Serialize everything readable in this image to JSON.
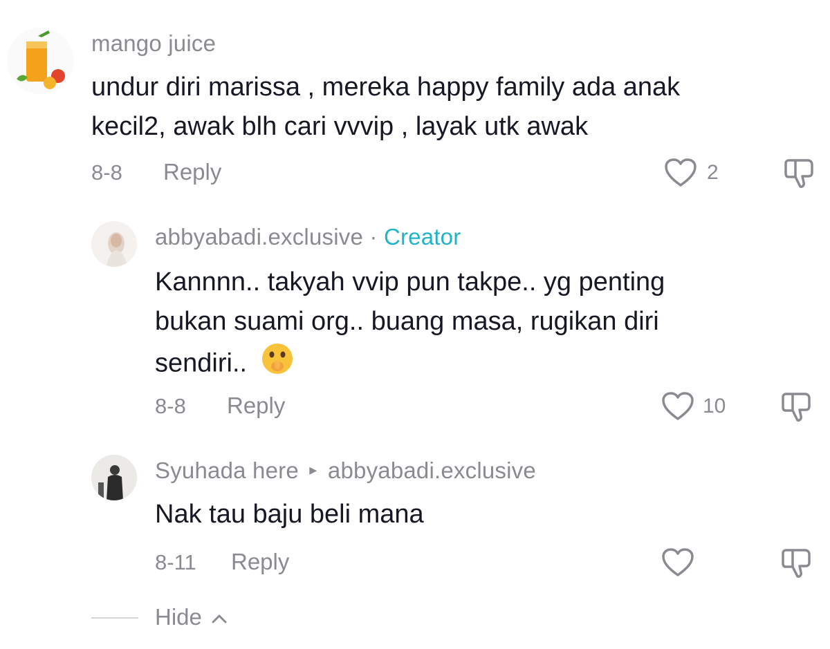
{
  "comments": [
    {
      "username": "mango juice",
      "avatar_icon": "mango-juice-avatar-icon",
      "text_line1": "undur diri marissa , mereka happy family ada anak",
      "text_line2": "kecil2, awak blh cari vvvip , layak utk awak",
      "date": "8-8",
      "reply_label": "Reply",
      "likes": "2"
    },
    {
      "username": "abbyabadi.exclusive",
      "separator": "·",
      "badge": "Creator",
      "avatar_icon": "woman-avatar-icon",
      "text_line1": "Kannnn.. takyah vvip pun takpe.. yg penting",
      "text_line2": "bukan suami org.. buang masa, rugikan diri",
      "text_line3": "sendiri..",
      "emoji": "shushing-face-emoji",
      "date": "8-8",
      "reply_label": "Reply",
      "likes": "10"
    },
    {
      "username": "Syuhada here",
      "reply_to": "abbyabadi.exclusive",
      "avatar_icon": "person-avatar-icon",
      "text_line1": "Nak tau baju beli mana",
      "date": "8-11",
      "reply_label": "Reply",
      "likes": ""
    }
  ],
  "hide": {
    "label": "Hide",
    "icon": "chevron-up-icon"
  },
  "colors": {
    "text": "#161823",
    "secondary": "#8a8b91",
    "creator": "#20b4c6"
  }
}
